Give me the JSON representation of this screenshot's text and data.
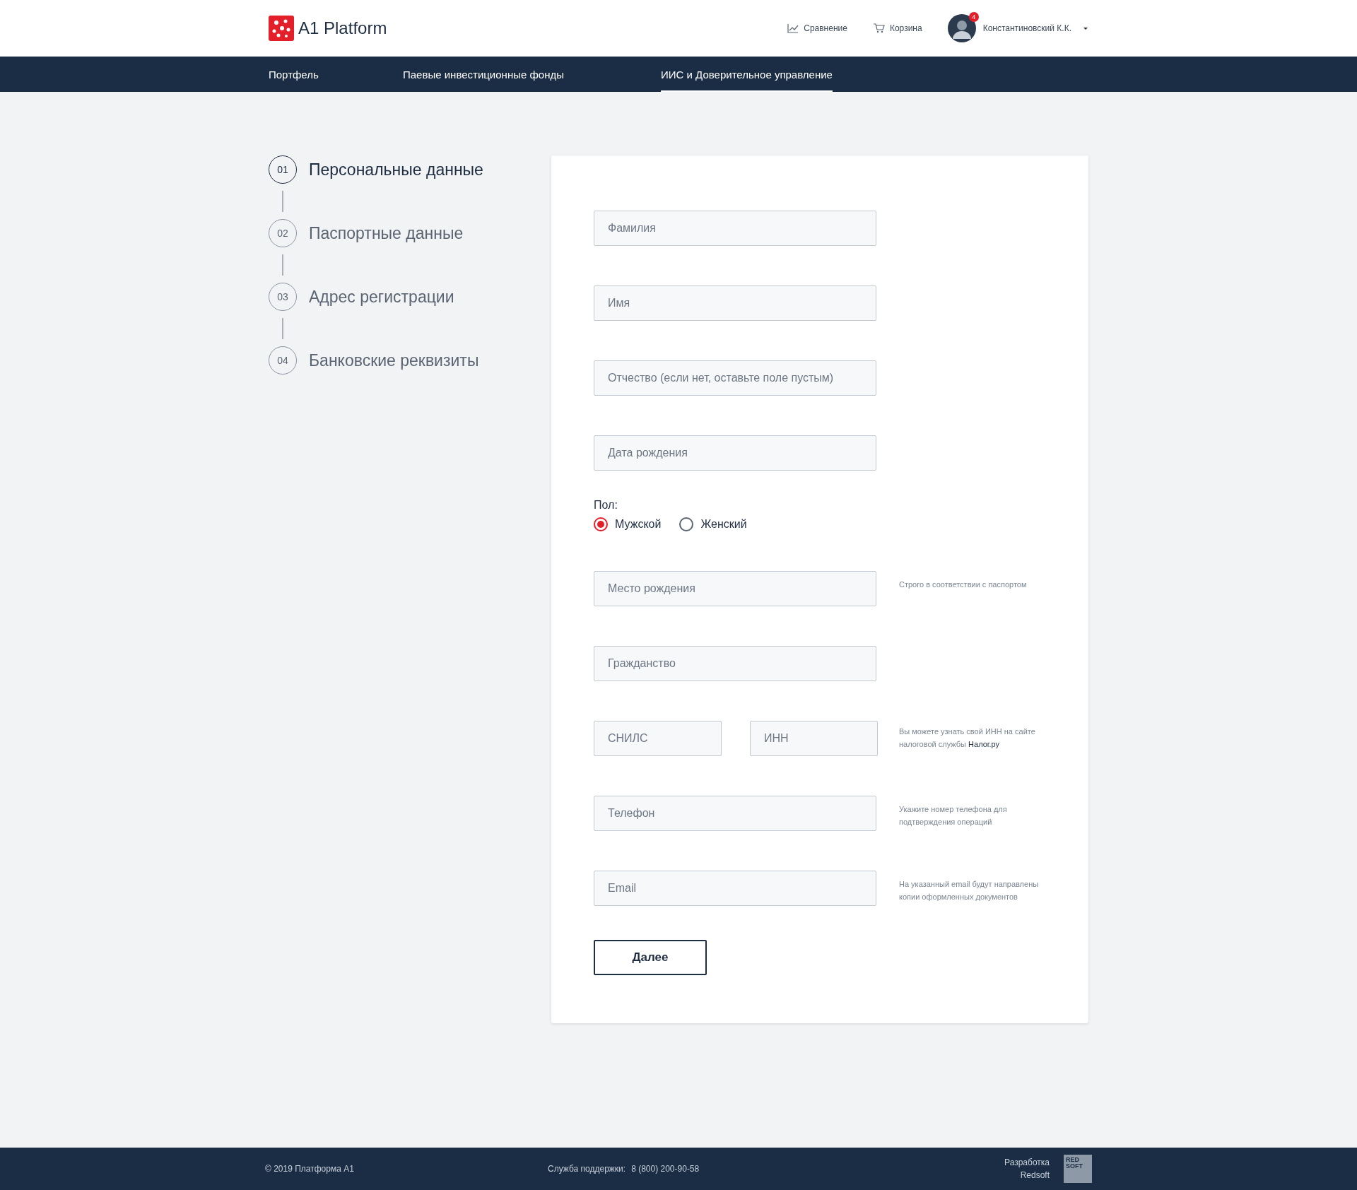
{
  "header": {
    "logo": "A1 Platform",
    "links": [
      {
        "kind": "chart",
        "label": "Сравнение"
      },
      {
        "kind": "cart",
        "label": "Корзина"
      }
    ],
    "user": {
      "name": "Константиновский К.К.",
      "badge": "4"
    }
  },
  "nav": [
    {
      "label": "Портфель",
      "selected": false
    },
    {
      "label": "Паевые инвестиционные фонды",
      "selected": false
    },
    {
      "label": "ИИС и Доверительное управление",
      "selected": true
    }
  ],
  "steps": [
    {
      "number": "01",
      "label": "Персональные данные",
      "selected": true
    },
    {
      "number": "02",
      "label": "Паспортные данные",
      "selected": false
    },
    {
      "number": "03",
      "label": "Адрес регистрации",
      "selected": false
    },
    {
      "number": "04",
      "label": "Банковские реквизиты",
      "selected": false
    }
  ],
  "form": {
    "rows": [
      {
        "kind": "field",
        "placeholder": "Фамилия"
      },
      {
        "kind": "field",
        "placeholder": "Имя"
      },
      {
        "kind": "field",
        "placeholder": "Отчество (если нет, оставьте поле пустым)"
      },
      {
        "kind": "field",
        "placeholder": "Дата рождения"
      },
      {
        "kind": "radio",
        "label": "Пол:",
        "options": [
          {
            "label": "Мужской",
            "selected": true
          },
          {
            "label": "Женский",
            "selected": false
          }
        ]
      },
      {
        "kind": "field",
        "placeholder": "Место рождения",
        "hint": "Строго в соответствии с паспортом"
      },
      {
        "kind": "field",
        "placeholder": "Гражданство"
      },
      {
        "kind": "pair",
        "placeholders": [
          "СНИЛС",
          "ИНН"
        ],
        "hint": "Вы можете узнать свой ИНН на сайте налоговой службы",
        "hint_link": "Налог.ру"
      },
      {
        "kind": "field",
        "placeholder": "Телефон",
        "hint": "Укажите номер телефона для подтверждения операций"
      },
      {
        "kind": "field",
        "placeholder": "Email",
        "hint": "На указанный email будут направлены копии оформленных документов"
      }
    ],
    "submit": "Далее"
  },
  "footer": {
    "copyright": "© 2019  Платформа А1",
    "support_label": "Служба поддержки:",
    "support_phone": "8 (800) 200-90-58",
    "developer": "Разработка Redsoft",
    "developer_logo": "RED SOFT"
  }
}
